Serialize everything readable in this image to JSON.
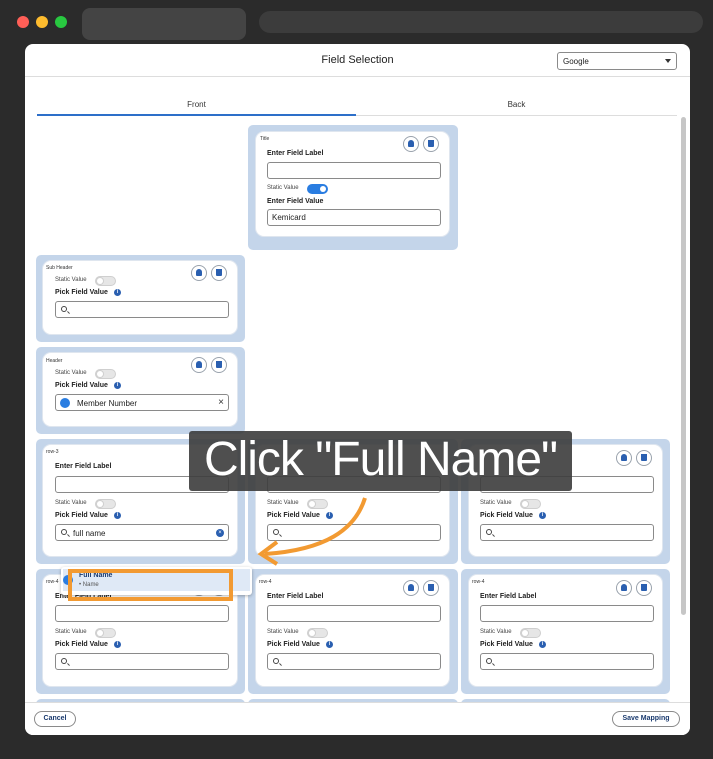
{
  "modal": {
    "title": "Field Selection",
    "provider_select": "Google"
  },
  "tabs": [
    "Front",
    "Back"
  ],
  "cards": {
    "title_card": {
      "slot": "Title",
      "label_heading": "Enter Field Label",
      "label_value": "",
      "static_label": "Static Value",
      "static_on": true,
      "value_heading": "Enter Field Value",
      "value": "Kemicard"
    },
    "subheader_card": {
      "slot": "Sub Header",
      "static_label": "Static Value",
      "static_on": false,
      "pick_label": "Pick Field Value"
    },
    "header_card": {
      "slot": "Header",
      "static_label": "Static Value",
      "static_on": false,
      "pick_label": "Pick Field Value",
      "pick_value": "Member Number"
    },
    "row3_left": {
      "slot": "row-3",
      "label_heading": "Enter Field Label",
      "static_label": "Static Value",
      "pick_label": "Pick Field Value",
      "search_value": "full name"
    },
    "row3_mid": {
      "static_label": "Static Value",
      "pick_label": "Pick Field Value"
    },
    "row3_right": {
      "static_label": "Static Value",
      "pick_label": "Pick Field Value"
    },
    "row4": [
      {
        "slot": "row-4",
        "label_heading": "Enter Field Label",
        "static_label": "Static Value",
        "pick_label": "Pick Field Value"
      },
      {
        "slot": "row-4",
        "label_heading": "Enter Field Label",
        "static_label": "Static Value",
        "pick_label": "Pick Field Value"
      },
      {
        "slot": "row-4",
        "label_heading": "Enter Field Label",
        "static_label": "Static Value",
        "pick_label": "Pick Field Value"
      }
    ]
  },
  "dropdown": {
    "item_title": "Full Name",
    "item_sub": "• Name"
  },
  "footer": {
    "cancel_label": "Cancel",
    "save_label": "Save Mapping"
  },
  "instruction": {
    "text": "Click \"Full Name\"",
    "highlight_color": "#f29a32"
  }
}
